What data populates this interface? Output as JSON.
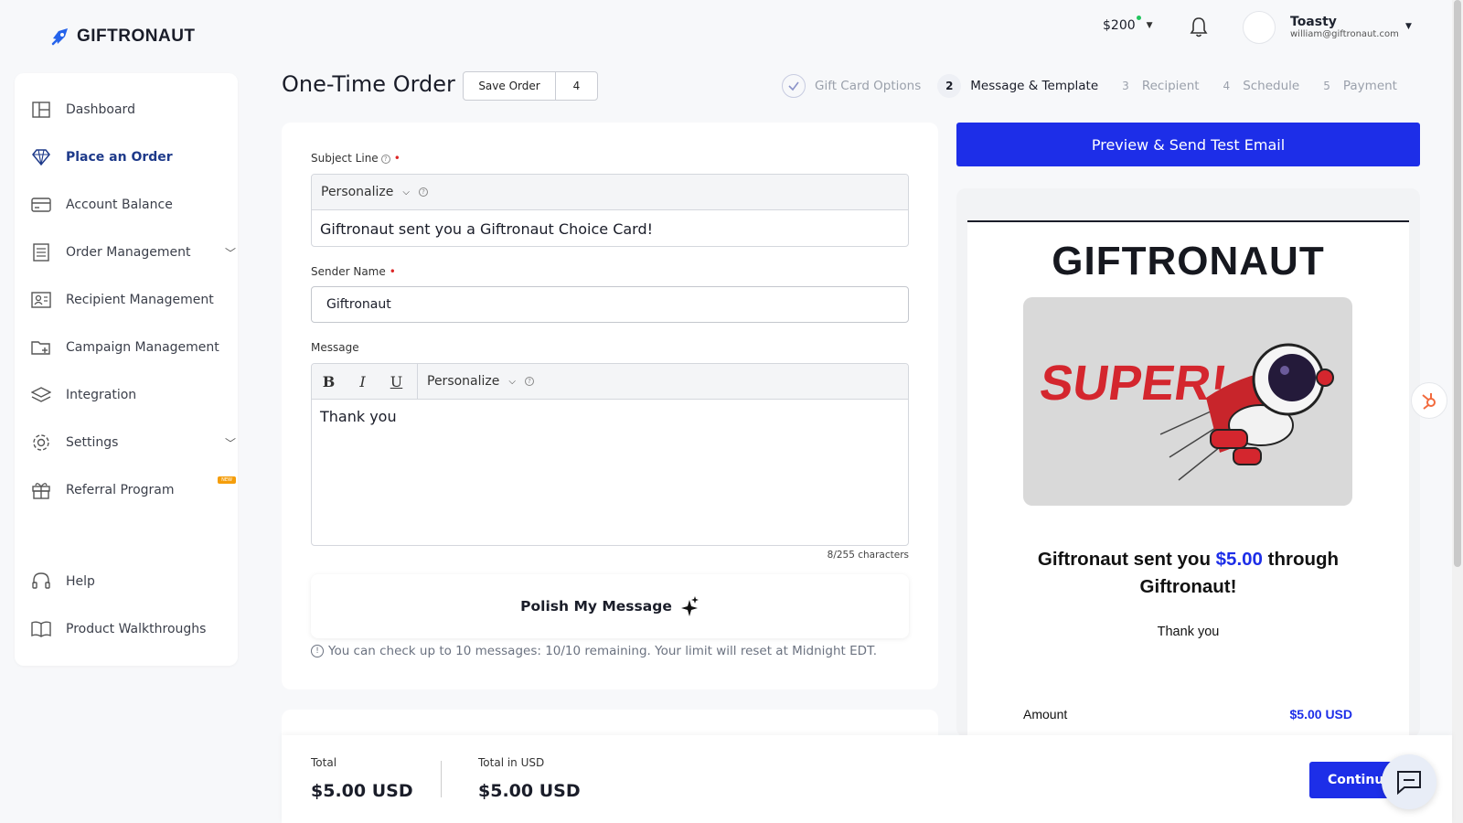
{
  "brand": {
    "name": "GIFTRONAUT",
    "accent": "#1d2ee8"
  },
  "topbar": {
    "balance": "$200",
    "user_name": "Toasty",
    "user_email": "william@giftronaut.com"
  },
  "sidebar": {
    "items": [
      {
        "label": "Dashboard",
        "icon": "dashboard-icon"
      },
      {
        "label": "Place an Order",
        "icon": "diamond-icon",
        "active": true
      },
      {
        "label": "Account Balance",
        "icon": "card-icon"
      },
      {
        "label": "Order Management",
        "icon": "receipt-icon",
        "expandable": true
      },
      {
        "label": "Recipient Management",
        "icon": "contact-icon"
      },
      {
        "label": "Campaign Management",
        "icon": "folder-plus-icon"
      },
      {
        "label": "Integration",
        "icon": "layers-icon"
      },
      {
        "label": "Settings",
        "icon": "gear-icon",
        "expandable": true
      },
      {
        "label": "Referral Program",
        "icon": "gift-icon",
        "badge": "NEW"
      },
      {
        "label": "Help",
        "icon": "headset-icon"
      },
      {
        "label": "Product Walkthroughs",
        "icon": "book-icon"
      }
    ]
  },
  "page": {
    "title": "One-Time Order",
    "save_label": "Save Order",
    "save_count": "4"
  },
  "steps": [
    {
      "num": "",
      "label": "Gift Card Options",
      "state": "done"
    },
    {
      "num": "2",
      "label": "Message & Template",
      "state": "current"
    },
    {
      "num": "3",
      "label": "Recipient",
      "state": "upcoming"
    },
    {
      "num": "4",
      "label": "Schedule",
      "state": "upcoming"
    },
    {
      "num": "5",
      "label": "Payment",
      "state": "upcoming"
    }
  ],
  "form": {
    "subject_label": "Subject Line",
    "personalize_label": "Personalize",
    "subject_value": "Giftronaut sent you a Giftronaut Choice Card!",
    "sender_label": "Sender Name",
    "sender_value": "Giftronaut",
    "message_label": "Message",
    "message_value": "Thank you",
    "char_count": "8/255 characters",
    "polish_label": "Polish My Message",
    "info_text": "You can check up to 10 messages: 10/10 remaining. Your limit will reset at Midnight EDT."
  },
  "preview": {
    "button_label": "Preview & Send Test Email",
    "email_logo": "GIFTRONAUT",
    "card_image_text": "SUPER!",
    "headline_pre": "Giftronaut sent you ",
    "headline_amount": "$5.00",
    "headline_post": " through Giftronaut!",
    "message": "Thank you",
    "amount_label": "Amount",
    "amount_value": "$5.00 USD"
  },
  "footer": {
    "total_label": "Total",
    "total_value": "$5.00 USD",
    "total_usd_label": "Total in USD",
    "total_usd_value": "$5.00 USD",
    "continue_label": "Continue"
  }
}
